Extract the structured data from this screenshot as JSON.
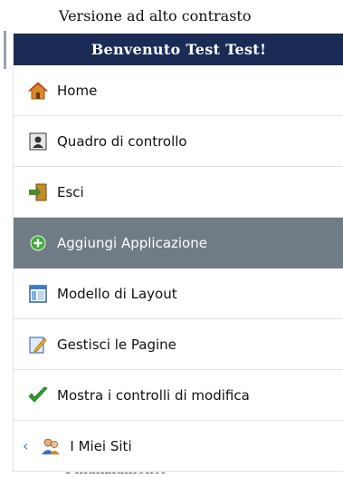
{
  "header": {
    "contrast_link": "Versione ad alto contrasto"
  },
  "menu": {
    "welcome": "Benvenuto Test Test!",
    "items": [
      {
        "label": "Home",
        "icon": "home-icon"
      },
      {
        "label": "Quadro di controllo",
        "icon": "dashboard-icon"
      },
      {
        "label": "Esci",
        "icon": "exit-door-icon"
      },
      {
        "label": "Aggiungi Applicazione",
        "icon": "add-circle-icon",
        "active": true
      },
      {
        "label": "Modello di Layout",
        "icon": "layout-icon"
      },
      {
        "label": "Gestisci le Pagine",
        "icon": "edit-pages-icon"
      },
      {
        "label": "Mostra i controlli di modifica",
        "icon": "checkmark-icon"
      },
      {
        "label": "I Miei Siti",
        "icon": "users-icon"
      }
    ]
  },
  "below": {
    "partial_text": "Finanziamento"
  }
}
